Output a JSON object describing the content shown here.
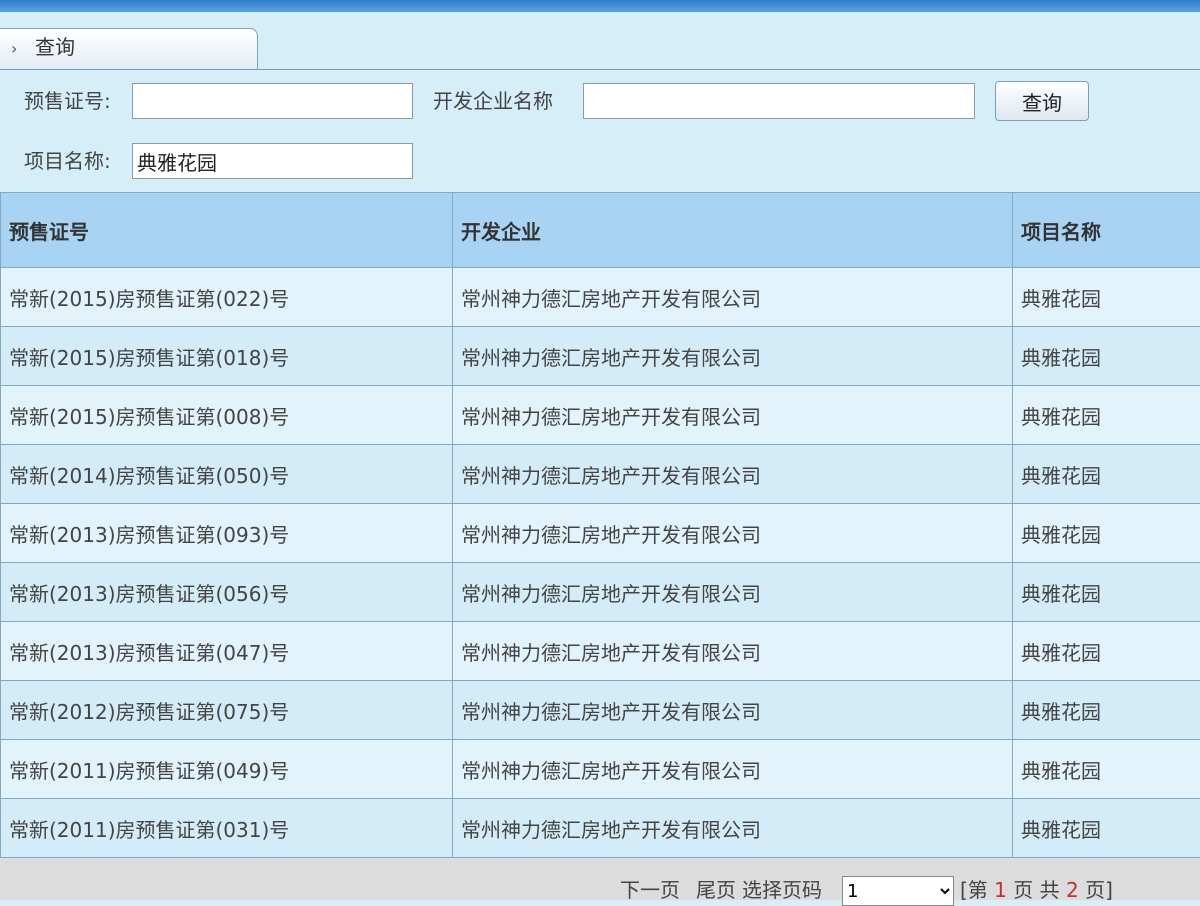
{
  "tab": {
    "label": "查询"
  },
  "form": {
    "presale_label": "预售证号:",
    "presale_value": "",
    "company_label": "开发企业名称",
    "company_value": "",
    "project_label": "项目名称:",
    "project_value": "典雅花园",
    "query_button": "查询"
  },
  "table": {
    "headers": [
      "预售证号",
      "开发企业",
      "项目名称"
    ],
    "rows": [
      [
        "常新(2015)房预售证第(022)号",
        "常州神力德汇房地产开发有限公司",
        "典雅花园"
      ],
      [
        "常新(2015)房预售证第(018)号",
        "常州神力德汇房地产开发有限公司",
        "典雅花园"
      ],
      [
        "常新(2015)房预售证第(008)号",
        "常州神力德汇房地产开发有限公司",
        "典雅花园"
      ],
      [
        "常新(2014)房预售证第(050)号",
        "常州神力德汇房地产开发有限公司",
        "典雅花园"
      ],
      [
        "常新(2013)房预售证第(093)号",
        "常州神力德汇房地产开发有限公司",
        "典雅花园"
      ],
      [
        "常新(2013)房预售证第(056)号",
        "常州神力德汇房地产开发有限公司",
        "典雅花园"
      ],
      [
        "常新(2013)房预售证第(047)号",
        "常州神力德汇房地产开发有限公司",
        "典雅花园"
      ],
      [
        "常新(2012)房预售证第(075)号",
        "常州神力德汇房地产开发有限公司",
        "典雅花园"
      ],
      [
        "常新(2011)房预售证第(049)号",
        "常州神力德汇房地产开发有限公司",
        "典雅花园"
      ],
      [
        "常新(2011)房预售证第(031)号",
        "常州神力德汇房地产开发有限公司",
        "典雅花园"
      ]
    ]
  },
  "pager": {
    "next": "下一页",
    "last": "尾页",
    "select_label": "选择页码",
    "selected_page": "1",
    "page_info_open": "[第",
    "current_page": "1",
    "page_info_mid": "页 共",
    "total_pages": "2",
    "page_info_close": "页]"
  }
}
